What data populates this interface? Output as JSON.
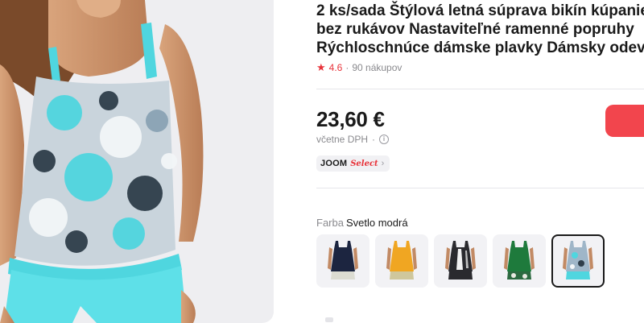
{
  "product": {
    "title_lines": [
      "2 ks/sada Štýlová letná súprava bikín kúpanie",
      "bez rukávov Nastaviteľné ramenné popruhy",
      "Rýchloschnúce dámske plavky Dámsky odev"
    ],
    "rating": "4.6",
    "rating_separator": "·",
    "purchases": "90 nákupov",
    "price": "23,60 €",
    "vat_note": "včetne DPH",
    "vat_separator": "·",
    "badge": {
      "brand": "JOOM",
      "program": "Select"
    },
    "color_label": "Farba",
    "color_value": "Svetlo modrá"
  },
  "colors": {
    "accent": "#f2454d",
    "rating_star": "#e8333a",
    "print_main": "#4fd6df"
  },
  "icons": {
    "rating": "star-icon",
    "vat_info": "info-icon",
    "badge_arrow": "chevron-right-icon"
  },
  "swatches": [
    {
      "name": "navy",
      "top": "#1c2540",
      "bottom": "#dcdcd2",
      "selected": false
    },
    {
      "name": "yellow",
      "top": "#f0a622",
      "bottom": "#cfc79c",
      "selected": false
    },
    {
      "name": "black-white",
      "top": "#2a2a2e",
      "bottom": "#2a2a2e",
      "selected": false
    },
    {
      "name": "green",
      "top": "#1e7a3c",
      "bottom": "#2c6a40",
      "selected": false
    },
    {
      "name": "light-blue",
      "top": "#9fb6c8",
      "bottom": "#4fd6df",
      "selected": true
    }
  ]
}
